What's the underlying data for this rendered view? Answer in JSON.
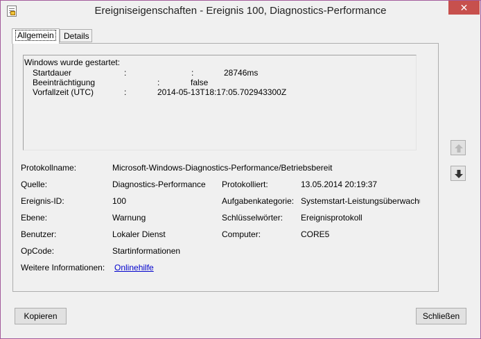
{
  "window": {
    "title": "Ereigniseigenschaften - Ereignis 100, Diagnostics-Performance",
    "close_glyph": "✕"
  },
  "tabs": [
    {
      "label": "Allgemein",
      "active": true
    },
    {
      "label": "Details",
      "active": false
    }
  ],
  "description": {
    "header": "Windows wurde gestartet:",
    "rows": [
      {
        "label": "Startdauer",
        "sep1": ":",
        "sep2": ":",
        "value": "28746ms"
      },
      {
        "label": "Beeinträchtigung",
        "sep1": ":",
        "value": "false"
      },
      {
        "label": "Vorfallzeit (UTC)",
        "sep1": ":",
        "value": "2014-05-13T18:17:05.702943300Z"
      }
    ]
  },
  "fields": {
    "protokollname": {
      "label": "Protokollname:",
      "value": "Microsoft-Windows-Diagnostics-Performance/Betriebsbereit"
    },
    "quelle": {
      "label": "Quelle:",
      "value": "Diagnostics-Performance"
    },
    "protokolliert": {
      "label": "Protokolliert:",
      "value": "13.05.2014 20:19:37"
    },
    "ereignis_id": {
      "label": "Ereignis-ID:",
      "value": "100"
    },
    "aufgabenkategorie": {
      "label": "Aufgabenkategorie:",
      "value": "Systemstart-Leistungsüberwachu"
    },
    "ebene": {
      "label": "Ebene:",
      "value": "Warnung"
    },
    "schluesselwoerter": {
      "label": "Schlüsselwörter:",
      "value": "Ereignisprotokoll"
    },
    "benutzer": {
      "label": "Benutzer:",
      "value": "Lokaler Dienst"
    },
    "computer": {
      "label": "Computer:",
      "value": "CORE5"
    },
    "opcode": {
      "label": "OpCode:",
      "value": "Startinformationen"
    },
    "weitere": {
      "label": "Weitere Informationen:",
      "value": "Onlinehilfe"
    }
  },
  "buttons": {
    "copy": "Kopieren",
    "close": "Schließen"
  },
  "colors": {
    "close_button": "#c7504d",
    "link": "#0000cc"
  }
}
